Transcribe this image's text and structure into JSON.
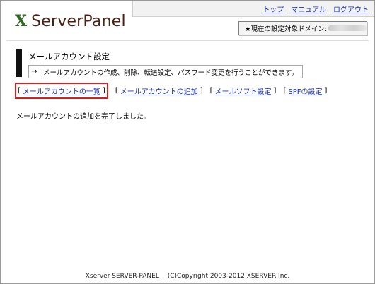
{
  "logo": {
    "mark": "X",
    "text": "ServerPanel"
  },
  "topnav": {
    "items": [
      "トップ",
      "マニュアル",
      "ログアウト"
    ]
  },
  "domain": {
    "label": "★現在の設定対象ドメイン:"
  },
  "section": {
    "title": "メールアカウント設定",
    "arrow": "→",
    "description": "メールアカウントの作成、削除、転送設定、パスワード変更を行うことができます。"
  },
  "menu": {
    "bracket_open": "[",
    "bracket_close": "]",
    "items": [
      "メールアカウントの一覧",
      "メールアカウントの追加",
      "メールソフト設定",
      "SPFの設定"
    ]
  },
  "message": "メールアカウントの追加を完了しました。",
  "footer": "Xserver SERVER-PANEL　 (C)Copyright 2003-2012 XSERVER Inc.",
  "colors": {
    "accent_red": "#d62020",
    "link": "#1a2fb0",
    "logo_green": "#2f6a22",
    "logo_brown": "#4a1f14"
  }
}
